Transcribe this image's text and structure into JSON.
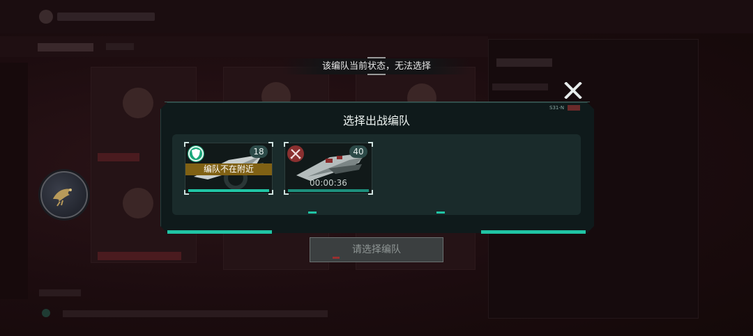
{
  "toast": {
    "message": "该编队当前状态，无法选择"
  },
  "close_icon": "close-x-icon",
  "dialog": {
    "title": "选择出战编队",
    "code_label": "S31-N",
    "accent_color": "#20c4a4",
    "slots": [
      {
        "count": "18",
        "status_icon": "shield-icon",
        "status_color": "#1aa67a",
        "banner": "编队不在附近",
        "banner_color": "#806114",
        "bar_color": "#20c4a4"
      },
      {
        "count": "40",
        "status_icon": "crossed-swords-icon",
        "status_color": "#8a3030",
        "timer": "00:00:36",
        "bar_color": "#1d8f7c"
      }
    ]
  },
  "confirm_button": {
    "label": "请选择编队",
    "enabled": false
  },
  "emblem_icon": "bird-emblem-icon"
}
